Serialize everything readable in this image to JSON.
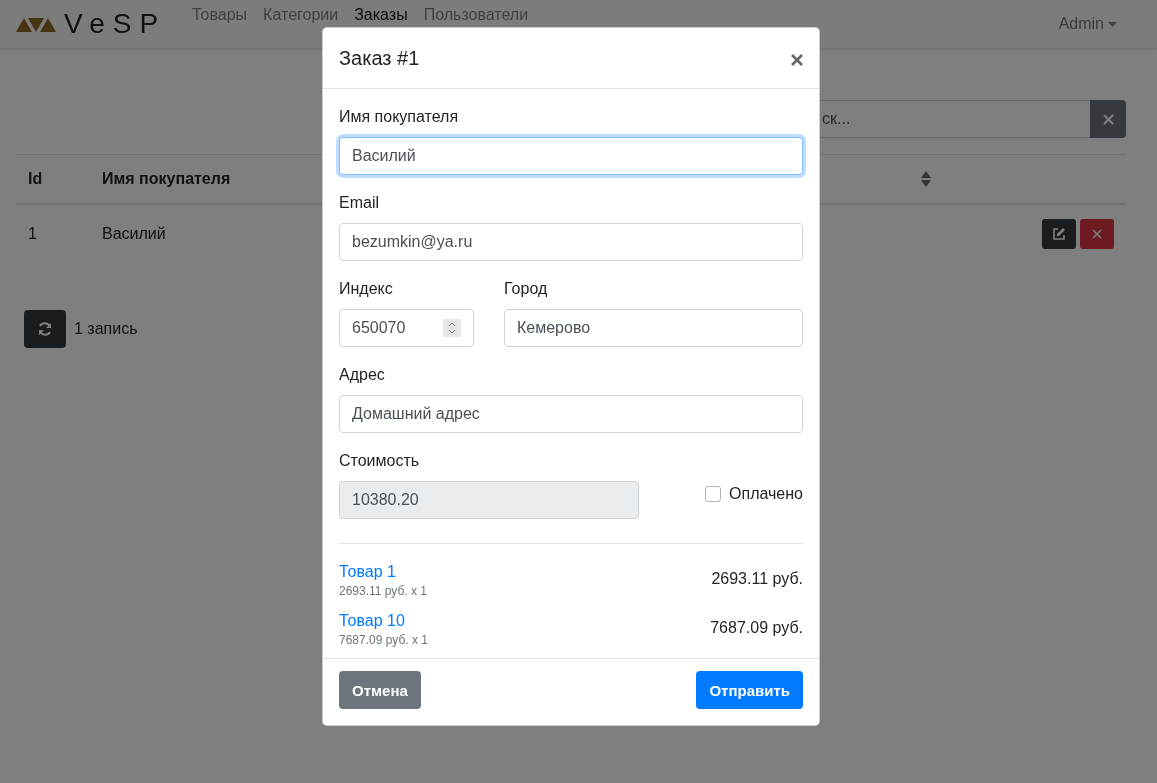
{
  "navbar": {
    "logo_text": "VeSP",
    "links": [
      {
        "label": "Товары",
        "selected": false
      },
      {
        "label": "Категории",
        "selected": false
      },
      {
        "label": "Заказы",
        "selected": true
      },
      {
        "label": "Пользователи",
        "selected": false
      }
    ],
    "user_menu": "Admin"
  },
  "search": {
    "placeholder": "ск..."
  },
  "table": {
    "columns": [
      "Id",
      "Имя покупателя"
    ],
    "rows": [
      {
        "cells": [
          "1",
          "Василий"
        ]
      }
    ]
  },
  "record_count": "1 запись",
  "modal": {
    "title": "Заказ #1",
    "customer_name": {
      "label": "Имя покупателя",
      "value": "Василий",
      "focused": true
    },
    "email": {
      "label": "Email",
      "value": "bezumkin@ya.ru",
      "focused": false
    },
    "postcode": {
      "label": "Индекс",
      "value": "650070",
      "focused": false
    },
    "city": {
      "label": "Город",
      "value": "Кемерово",
      "focused": false
    },
    "address": {
      "label": "Адрес",
      "value": "Домашний адрес",
      "focused": false
    },
    "cost": {
      "label": "Стоимость",
      "value": "10380.20",
      "readonly": true
    },
    "paid": {
      "label": "Оплачено",
      "checked": false
    },
    "items": [
      {
        "name": "Товар 1",
        "detail": "2693.11 руб. x 1",
        "total": "2693.11 руб."
      },
      {
        "name": "Товар 10",
        "detail": "7687.09 руб. x 1",
        "total": "7687.09 руб."
      }
    ],
    "cancel_button": "Отмена",
    "submit_button": "Отправить"
  }
}
